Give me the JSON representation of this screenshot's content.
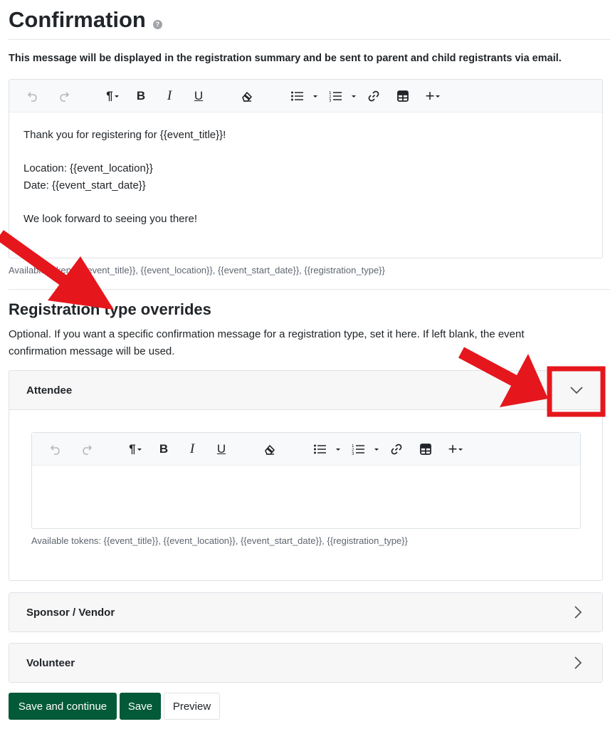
{
  "page": {
    "title": "Confirmation",
    "help_icon": "?",
    "intro": "This message will be displayed in the registration summary and be sent to parent and child registrants via email."
  },
  "toolbar": {
    "icons": [
      "undo-icon",
      "redo-icon",
      "paragraph-icon",
      "bold-icon",
      "italic-icon",
      "underline-icon",
      "eraser-icon",
      "bullet-list-icon",
      "numbered-list-icon",
      "link-icon",
      "table-icon",
      "plus-icon"
    ],
    "paragraph": "¶",
    "bold": "B",
    "italic": "I",
    "underline": "U",
    "plus": "+"
  },
  "main_editor": {
    "lines": [
      "Thank you for registering for {{event_title}}!",
      "",
      "Location: {{event_location}}",
      "Date: {{event_start_date}}",
      "",
      "We look forward to seeing you there!"
    ],
    "tokens": "Available tokens: {{event_title}}, {{event_location}}, {{event_start_date}}, {{registration_type}}"
  },
  "overrides": {
    "title": "Registration type overrides",
    "description": "Optional. If you want a specific confirmation message for a registration type, set it here. If left blank, the event confirmation message will be used.",
    "items": [
      {
        "label": "Attendee",
        "expanded": true,
        "tokens": "Available tokens: {{event_title}}, {{event_location}}, {{event_start_date}}, {{registration_type}}"
      },
      {
        "label": "Sponsor / Vendor",
        "expanded": false
      },
      {
        "label": "Volunteer",
        "expanded": false
      }
    ]
  },
  "actions": {
    "save_continue": "Save and continue",
    "save": "Save",
    "preview": "Preview"
  },
  "colors": {
    "primary": "#035a38",
    "annotation": "#e5171d"
  }
}
